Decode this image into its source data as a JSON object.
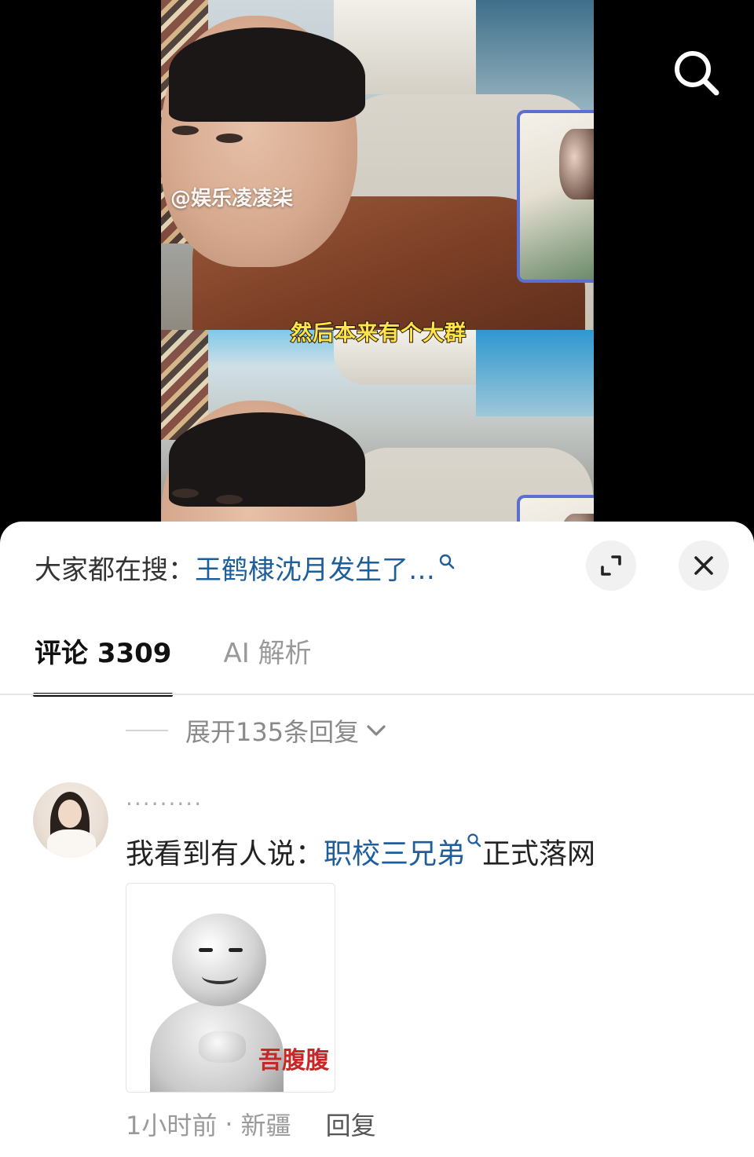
{
  "video": {
    "watermark": "@娱乐凌凌柒",
    "caption": "然后本来有个大群"
  },
  "trending": {
    "prefix": "大家都在搜：",
    "query": "王鹤棣沈月发生了…"
  },
  "tabs": [
    {
      "label": "评论 3309",
      "active": true
    },
    {
      "label": "AI 解析",
      "active": false
    }
  ],
  "replies": {
    "expand_label": "展开135条回复"
  },
  "comment": {
    "username": "·········",
    "text_prefix": "我看到有人说：",
    "text_link": "职校三兄弟",
    "text_suffix": "正式落网",
    "image_caption": "吾腹腹",
    "time": "1小时前",
    "separator": "·",
    "location": "新疆",
    "reply_label": "回复"
  },
  "colors": {
    "link": "#1e5e9a",
    "caption_yellow": "#ffe34a",
    "meme_red": "#c62828"
  },
  "icons": {
    "top_search": "search-icon",
    "inline_search": "search-icon",
    "expand": "expand-icon",
    "close": "close-icon",
    "chevron": "chevron-down-icon"
  }
}
